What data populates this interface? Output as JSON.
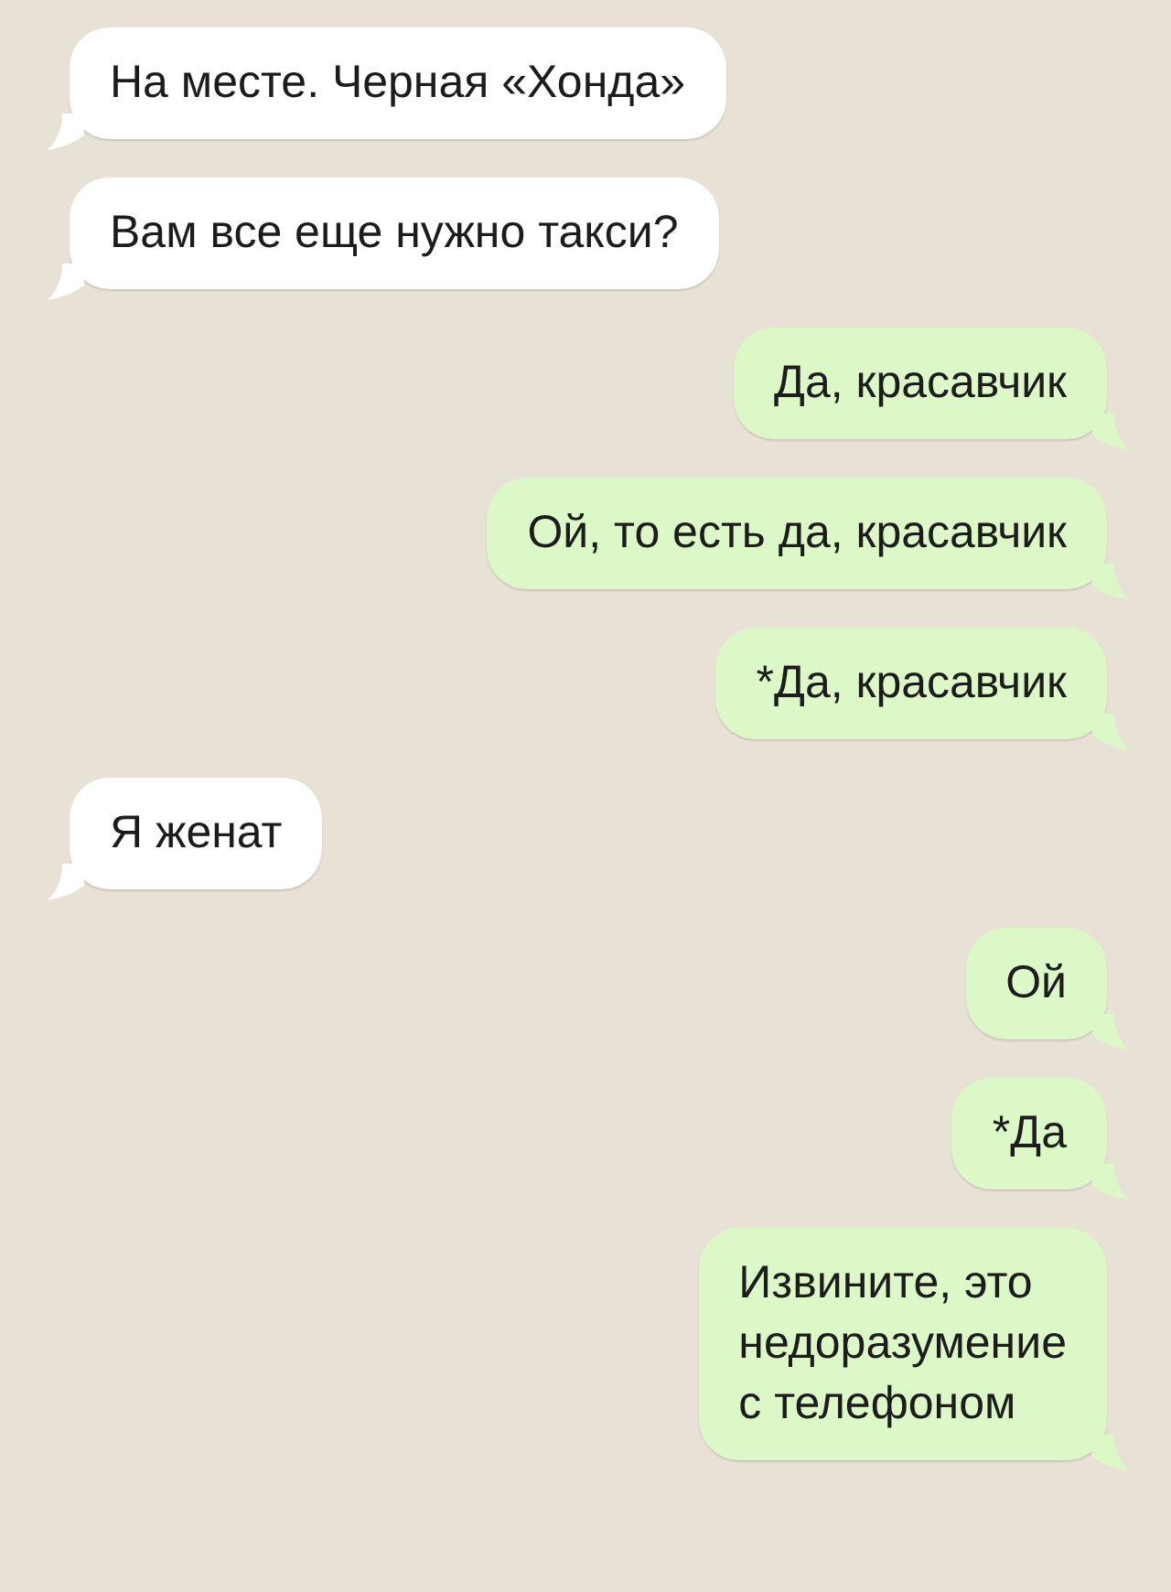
{
  "messages": [
    {
      "kind": "incoming",
      "text": "На месте. Черная «Хонда»"
    },
    {
      "kind": "incoming",
      "text": "Вам все еще нужно такси?"
    },
    {
      "kind": "outgoing",
      "text": "Да, красавчик"
    },
    {
      "kind": "outgoing",
      "text": "Ой, то есть да, красавчик"
    },
    {
      "kind": "outgoing",
      "text": "*Да, красавчик"
    },
    {
      "kind": "incoming",
      "text": "Я женат"
    },
    {
      "kind": "outgoing",
      "text": "Ой"
    },
    {
      "kind": "outgoing",
      "text": "*Да"
    },
    {
      "kind": "outgoing",
      "text": "Извините, это\nнедоразумение\nс телефоном"
    }
  ]
}
